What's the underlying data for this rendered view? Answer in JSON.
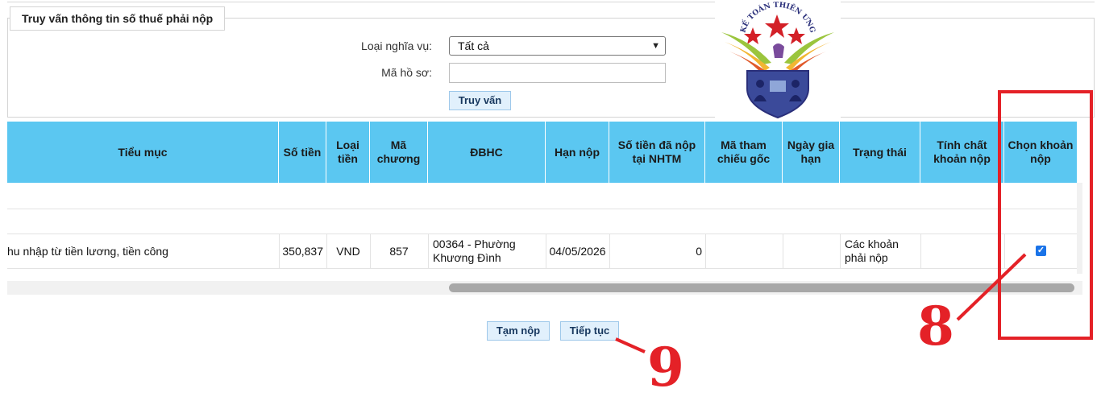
{
  "query_panel": {
    "legend": "Truy vấn thông tin số thuế phải nộp",
    "obligation_label": "Loại nghĩa vụ:",
    "obligation_value": "Tất cả",
    "file_code_label": "Mã hồ sơ:",
    "file_code_value": "",
    "query_button": "Truy vấn"
  },
  "logo": {
    "text": "KẾ TOÁN THIÊN ƯNG"
  },
  "table": {
    "columns": [
      "Tiểu mục",
      "Số tiền",
      "Loại tiền",
      "Mã chương",
      "ĐBHC",
      "Hạn nộp",
      "Số tiền đã nộp tại NHTM",
      "Mã tham chiếu gốc",
      "Ngày gia hạn",
      "Trạng thái",
      "Tính chất khoản nộp",
      "Chọn khoản nộp"
    ],
    "rows": [
      {
        "tieu_muc": "hu nhập từ tiền lương, tiền công",
        "so_tien": "350,837",
        "loai_tien": "VND",
        "ma_chuong": "857",
        "dbhc": "00364 - Phường Khương Đình",
        "han_nop": "04/05/2026",
        "so_tien_da_nop": "0",
        "ma_tham_chieu": "",
        "ngay_gia_han": "",
        "trang_thai": "Các khoản phải nộp",
        "tinh_chat": "",
        "chon": true
      }
    ]
  },
  "buttons": {
    "temp_pay": "Tạm nộp",
    "continue": "Tiếp tục"
  },
  "annotations": {
    "step8": "8",
    "step9": "9",
    "color": "#e42127"
  },
  "colors": {
    "header_bg": "#5bc7f1",
    "button_bg": "#e1f0fc"
  }
}
